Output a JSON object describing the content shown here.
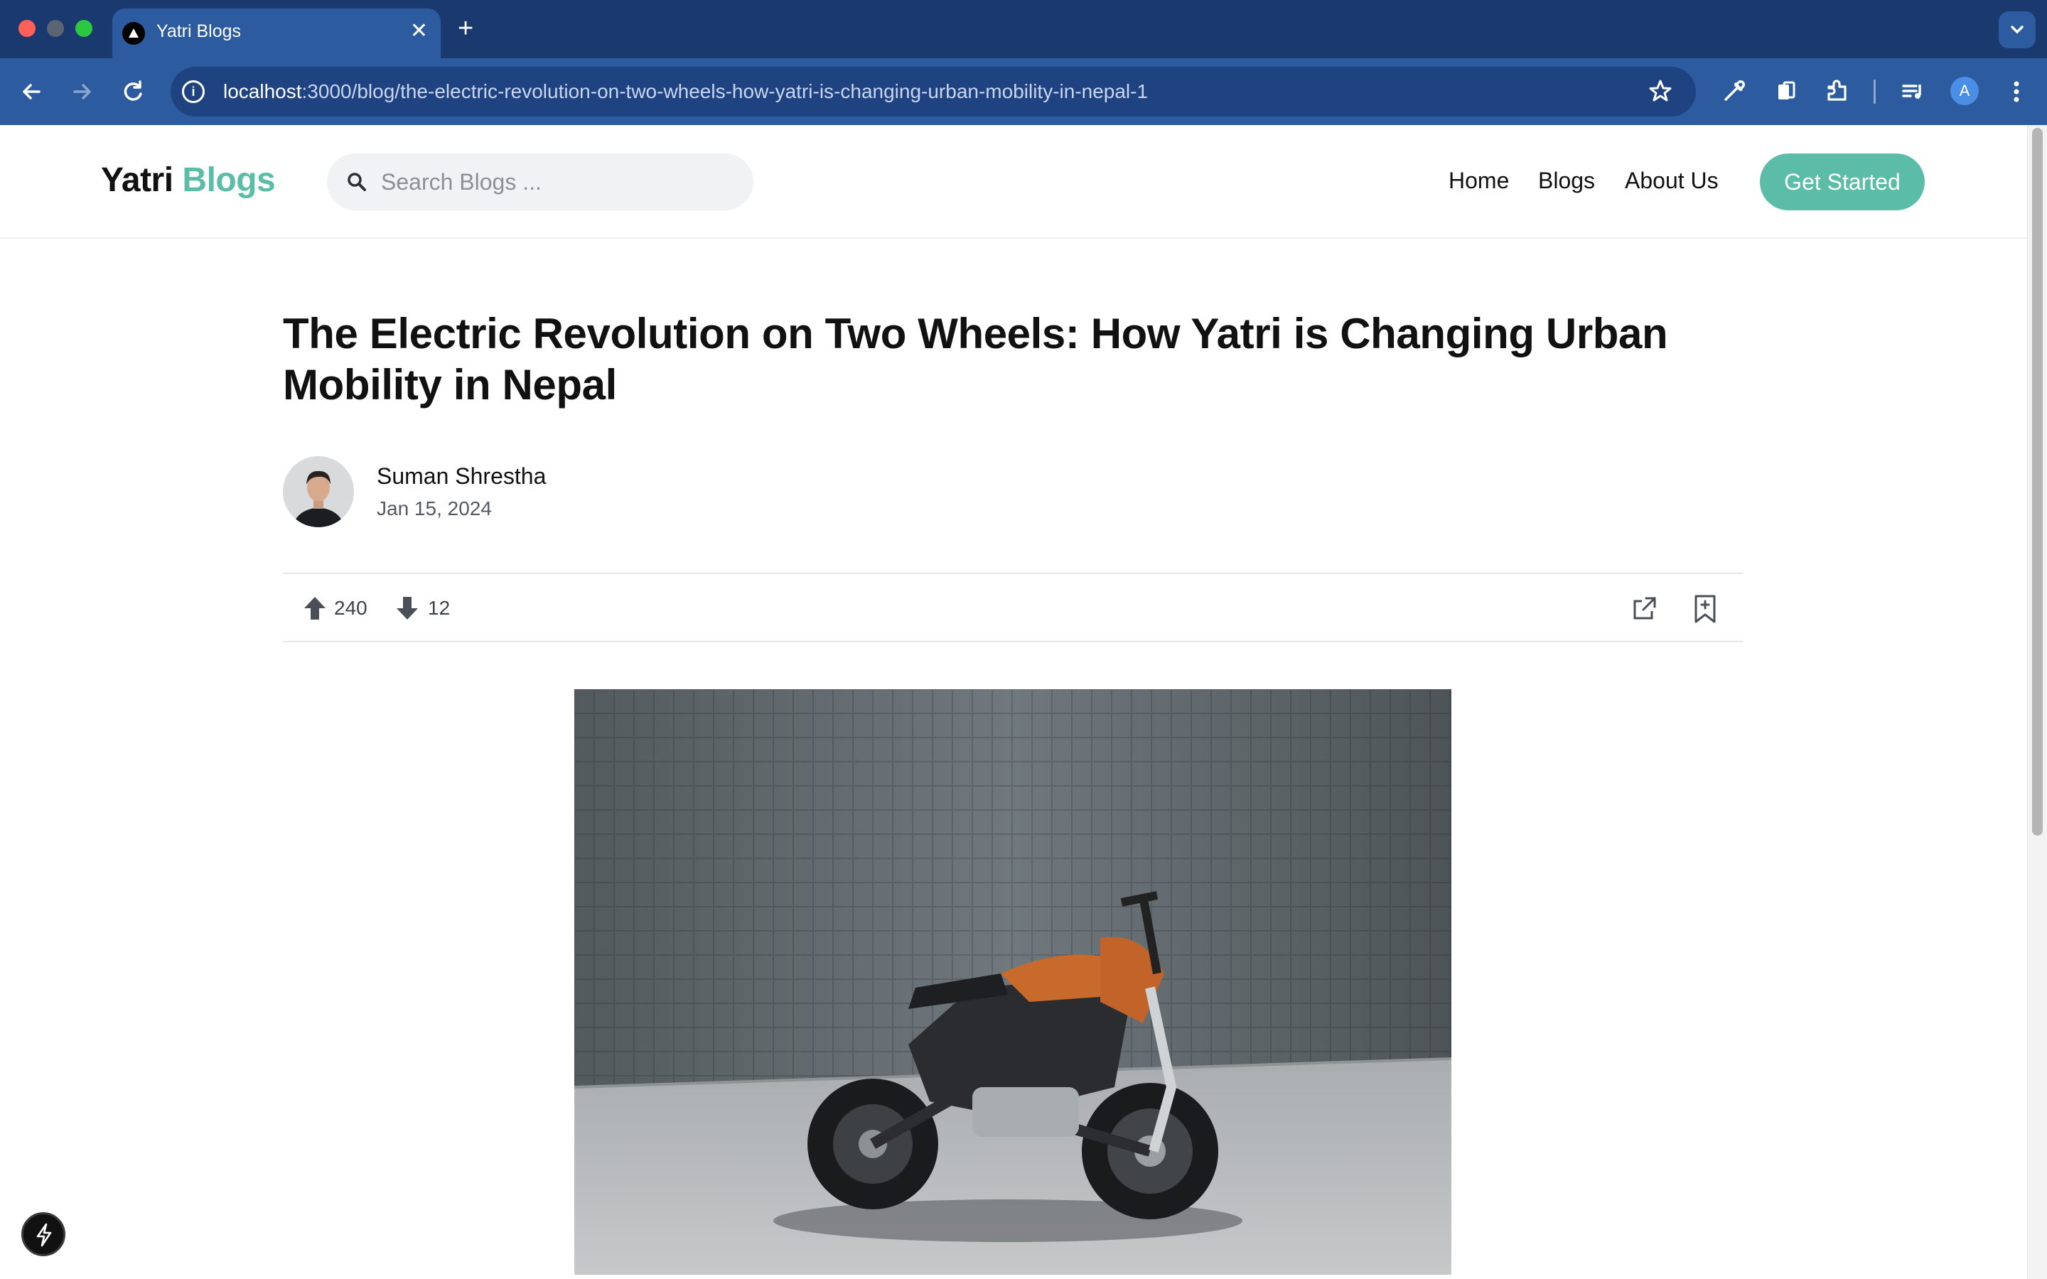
{
  "browser": {
    "tab_title": "Yatri Blogs",
    "url_host": "localhost",
    "url_path": ":3000/blog/the-electric-revolution-on-two-wheels-how-yatri-is-changing-urban-mobility-in-nepal-1",
    "profile_initial": "A"
  },
  "header": {
    "brand_primary": "Yatri",
    "brand_accent": "Blogs",
    "search_placeholder": "Search Blogs ...",
    "nav": [
      "Home",
      "Blogs",
      "About Us"
    ],
    "cta_label": "Get Started"
  },
  "article": {
    "title": "The Electric Revolution on Two Wheels: How Yatri is Changing Urban Mobility in Nepal",
    "author": "Suman Shrestha",
    "date": "Jan 15, 2024",
    "upvotes": "240",
    "downvotes": "12"
  },
  "colors": {
    "accent": "#5bbca8",
    "browser_frame": "#1d3f7a"
  }
}
